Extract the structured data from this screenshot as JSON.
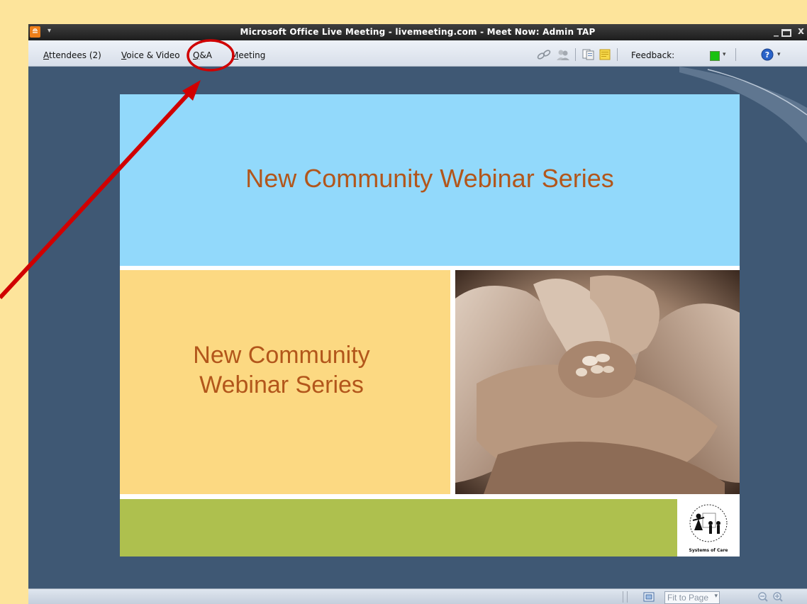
{
  "window": {
    "title": "Microsoft Office Live Meeting - livemeeting.com - Meet Now: Admin TAP",
    "minimize": "_",
    "close": "x"
  },
  "menubar": {
    "attendees": "Attendees (2)",
    "voice_video": "Voice & Video",
    "qa": "Q&A",
    "meeting": "Meeting",
    "feedback_label": "Feedback:"
  },
  "slide": {
    "title": "New Community Webinar Series",
    "subtitle_line1": "New Community",
    "subtitle_line2": "Webinar Series",
    "logo_caption": "Systems of Care"
  },
  "statusbar": {
    "zoom_value": "Fit to Page"
  },
  "colors": {
    "feedback_status": "#19c10f",
    "annotation": "#d00000",
    "slide_sky": "#92d9fb",
    "slide_sand": "#fcd982",
    "slide_green": "#aec04e"
  }
}
